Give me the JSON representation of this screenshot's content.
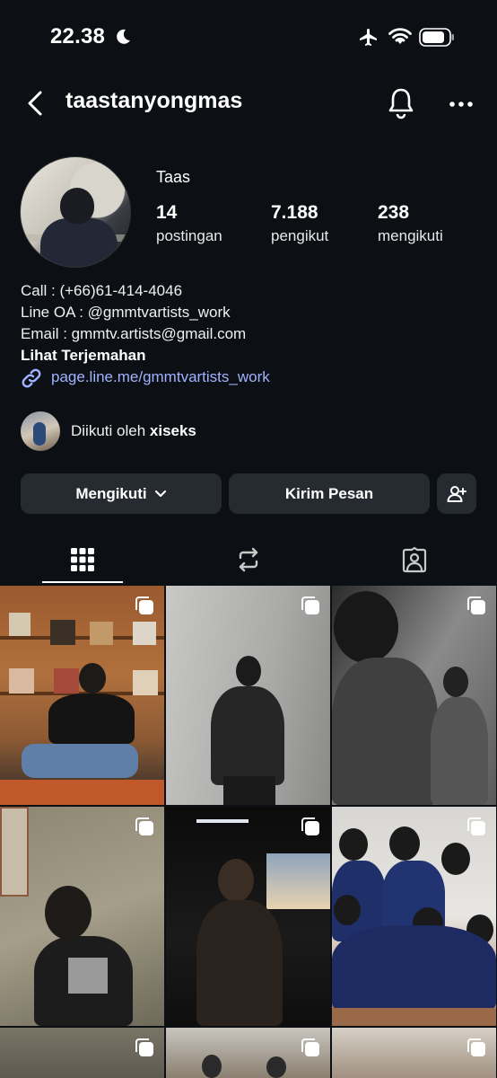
{
  "status": {
    "time": "22.38"
  },
  "header": {
    "username": "taastanyongmas"
  },
  "profile": {
    "display_name": "Taas",
    "stats": [
      {
        "value": "14",
        "label": "postingan"
      },
      {
        "value": "7.188",
        "label": "pengikut"
      },
      {
        "value": "238",
        "label": "mengikuti"
      }
    ],
    "bio": [
      "Call : (+66)61-414-4046",
      "Line OA : @gmmtvartists_work",
      "Email : gmmtv.artists@gmail.com"
    ],
    "translate_label": "Lihat Terjemahan",
    "link": "page.line.me/gmmtvartists_work",
    "followed_by_prefix": "Diikuti oleh",
    "followed_by_name": "xiseks"
  },
  "actions": {
    "following_label": "Mengikuti",
    "message_label": "Kirim Pesan"
  },
  "icons": {
    "back": "chevron-left-icon",
    "notifications": "bell-icon",
    "more": "more-horizontal-icon",
    "link": "link-icon",
    "add_person": "person-add-icon",
    "tab_grid": "grid-icon",
    "tab_reels": "repost-icon",
    "tab_tagged": "tagged-icon",
    "multi_post": "carousel-icon"
  },
  "colors": {
    "background": "#0c0f14",
    "button": "#262a31",
    "link": "#9fb3ff"
  }
}
